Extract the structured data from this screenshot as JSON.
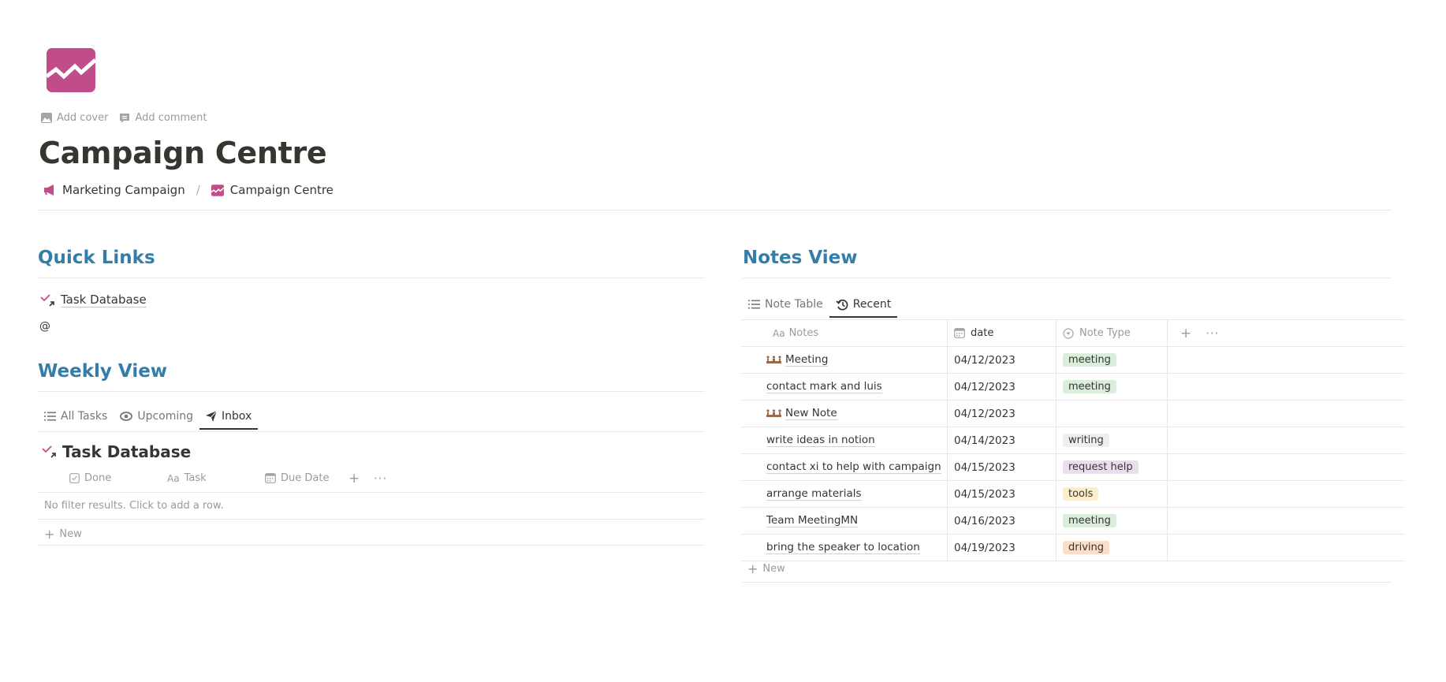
{
  "page": {
    "icon": "trending-chart-icon",
    "accent_color": "#c14c8a",
    "actions": [
      {
        "label": "Add cover",
        "icon": "image-icon"
      },
      {
        "label": "Add comment",
        "icon": "comment-icon"
      }
    ],
    "title": "Campaign Centre",
    "breadcrumb": [
      {
        "label": "Marketing Campaign",
        "icon": "megaphone-icon"
      },
      {
        "label": "Campaign Centre",
        "icon": "trending-chart-icon"
      }
    ],
    "breadcrumb_separator": "/"
  },
  "quick_links": {
    "heading": "Quick Links",
    "link_label": "Task Database",
    "mention_placeholder": "@"
  },
  "weekly_view": {
    "heading": "Weekly View",
    "tabs": [
      {
        "label": "All Tasks",
        "icon": "list-icon",
        "active": false
      },
      {
        "label": "Upcoming",
        "icon": "eye-icon",
        "active": false
      },
      {
        "label": "Inbox",
        "icon": "paper-plane-icon",
        "active": true
      }
    ],
    "database_title": "Task Database",
    "columns": [
      {
        "label": "Done",
        "icon": "checkbox-icon"
      },
      {
        "label": "Task",
        "icon": "text-icon"
      },
      {
        "label": "Due Date",
        "icon": "calendar-icon"
      }
    ],
    "empty_message": "No filter results. Click to add a row.",
    "new_label": "New"
  },
  "notes_view": {
    "heading": "Notes View",
    "tabs": [
      {
        "label": "Note Table",
        "icon": "list-icon",
        "active": false
      },
      {
        "label": "Recent",
        "icon": "history-icon",
        "active": true
      }
    ],
    "columns": [
      {
        "label": "Notes",
        "icon": "text-icon"
      },
      {
        "label": "date",
        "icon": "calendar-icon"
      },
      {
        "label": "Note Type",
        "icon": "select-icon"
      }
    ],
    "rows": [
      {
        "name": "Meeting",
        "has_icon": true,
        "date": "04/12/2023",
        "type": "meeting",
        "type_color": "#dbeddb"
      },
      {
        "name": "contact mark and luis",
        "has_icon": false,
        "date": "04/12/2023",
        "type": "meeting",
        "type_color": "#dbeddb"
      },
      {
        "name": "New Note",
        "has_icon": true,
        "date": "04/12/2023",
        "type": "",
        "type_color": ""
      },
      {
        "name": "write ideas in notion",
        "has_icon": false,
        "date": "04/14/2023",
        "type": "writing",
        "type_color": "#eeeeed"
      },
      {
        "name": "contact xi to help with campaign",
        "has_icon": false,
        "date": "04/15/2023",
        "type": "request help",
        "type_color": "#e8deee"
      },
      {
        "name": "arrange materials",
        "has_icon": false,
        "date": "04/15/2023",
        "type": "tools",
        "type_color": "#fbeecc"
      },
      {
        "name": "Team MeetingMN",
        "has_icon": false,
        "date": "04/16/2023",
        "type": "meeting",
        "type_color": "#dbeddb"
      },
      {
        "name": "bring the speaker to location",
        "has_icon": false,
        "date": "04/19/2023",
        "type": "driving",
        "type_color": "#fadec9"
      }
    ],
    "new_label": "New"
  }
}
